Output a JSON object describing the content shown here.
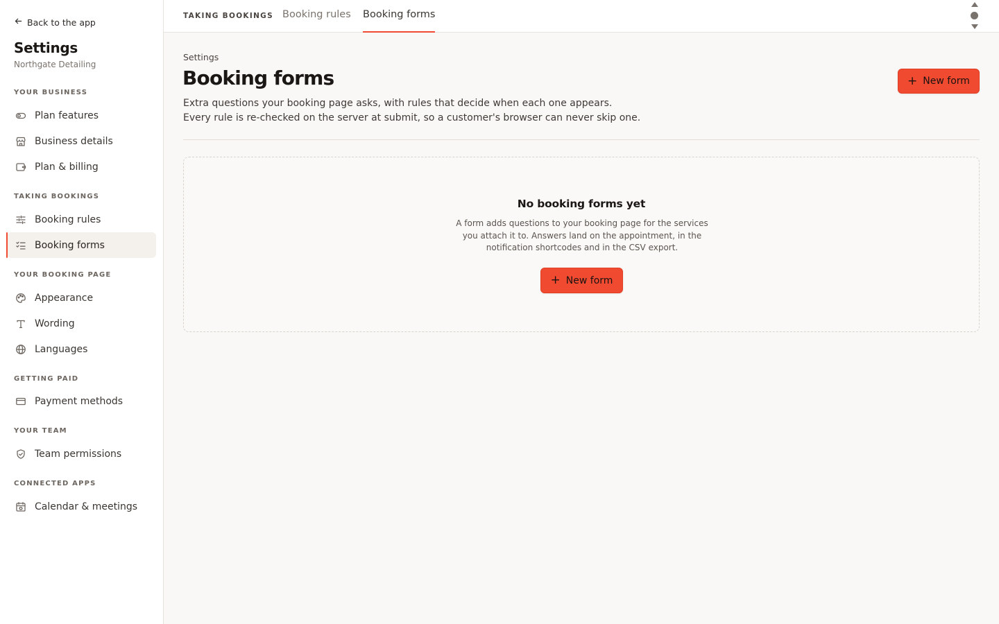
{
  "sidebar": {
    "back_label": "Back to the app",
    "title": "Settings",
    "subtitle": "Northgate Detailing",
    "sections": [
      {
        "label": "YOUR BUSINESS"
      },
      {
        "label": "TAKING BOOKINGS"
      },
      {
        "label": "YOUR BOOKING PAGE"
      },
      {
        "label": "GETTING PAID"
      },
      {
        "label": "YOUR TEAM"
      },
      {
        "label": "CONNECTED APPS"
      }
    ],
    "items": [
      {
        "label": "Plan features",
        "icon": "toggle-icon"
      },
      {
        "label": "Business details",
        "icon": "storefront-icon"
      },
      {
        "label": "Plan & billing",
        "icon": "wallet-icon"
      },
      {
        "label": "Booking rules",
        "icon": "sliders-icon"
      },
      {
        "label": "Booking forms",
        "icon": "checklist-icon",
        "active": true
      },
      {
        "label": "Appearance",
        "icon": "palette-icon"
      },
      {
        "label": "Wording",
        "icon": "type-icon"
      },
      {
        "label": "Languages",
        "icon": "globe-icon"
      },
      {
        "label": "Payment methods",
        "icon": "credit-card-icon"
      },
      {
        "label": "Team permissions",
        "icon": "shield-check-icon"
      },
      {
        "label": "Calendar & meetings",
        "icon": "calendar-sync-icon"
      }
    ]
  },
  "topbar": {
    "eyebrow": "TAKING BOOKINGS",
    "tabs": [
      {
        "label": "Booking rules"
      },
      {
        "label": "Booking forms",
        "active": true
      }
    ]
  },
  "main": {
    "breadcrumb": "Settings",
    "title": "Booking forms",
    "description": "Extra questions your booking page asks, with rules that decide when each one appears. Every rule is re-checked on the server at submit, so a customer's browser can never skip one.",
    "new_form_label": "New form",
    "empty": {
      "title": "No booking forms yet",
      "description": "A form adds questions to your booking page for the services you attach it to. Answers land on the appointment, in the notification shortcodes and in the CSV export.",
      "button_label": "New form"
    }
  },
  "colors": {
    "accent": "#f04a30",
    "sidebar_active_bg": "#f4f0ec",
    "page_bg": "#f9f8f6"
  }
}
